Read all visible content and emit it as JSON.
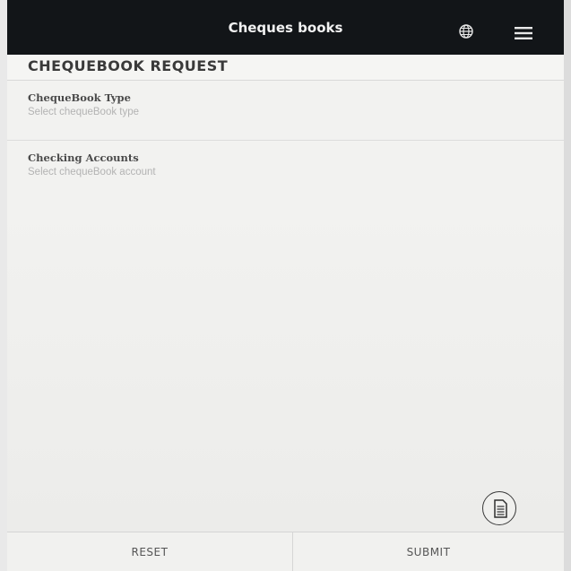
{
  "topbar": {
    "title": "Cheques books",
    "icons": [
      "globe-icon",
      "menu-icon"
    ]
  },
  "page": {
    "title": "CHEQUEBOOK REQUEST"
  },
  "fields": [
    {
      "label": "ChequeBook Type",
      "placeholder": "Select chequeBook type"
    },
    {
      "label": "Checking Accounts",
      "placeholder": "Select chequeBook account"
    }
  ],
  "fab": {
    "icon": "document-icon"
  },
  "footer": {
    "reset_label": "RESET",
    "submit_label": "SUBMIT"
  },
  "colors": {
    "topbar_bg": "#121518",
    "content_bg": "#f2f2f0",
    "text_primary": "#3a3a3a",
    "placeholder": "#b3b3b3"
  }
}
